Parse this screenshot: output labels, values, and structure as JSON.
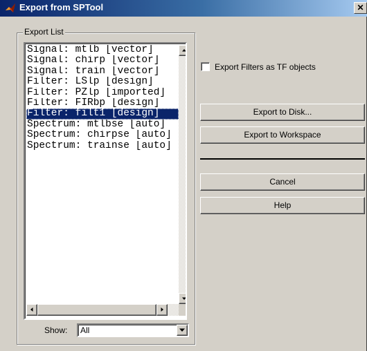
{
  "window": {
    "title": "Export from SPTool",
    "close_glyph": "✕",
    "icon": "matlab-logo-icon"
  },
  "export_list": {
    "group_label": "Export List",
    "items": [
      "Signal: mtlb [vector]",
      "Signal: chirp [vector]",
      "Signal: train [vector]",
      "Filter: LSlp [design]",
      "Filter: PZlp [imported]",
      "Filter: FIRbp [design]",
      "Filter: filt1 [design]",
      "Spectrum: mtlbse [auto]",
      "Spectrum: chirpse [auto]",
      "Spectrum: trainse [auto]"
    ],
    "selected_index": 6,
    "show_label": "Show:",
    "show_value": "All"
  },
  "options": {
    "export_tf_label": "Export Filters as TF objects",
    "export_tf_checked": false
  },
  "buttons": {
    "export_disk": "Export to Disk...",
    "export_workspace": "Export to Workspace",
    "cancel": "Cancel",
    "help": "Help"
  },
  "colors": {
    "title_gradient_start": "#0a246a",
    "title_gradient_end": "#a6caf0",
    "selection": "#0a246a",
    "face": "#d4d0c8"
  }
}
